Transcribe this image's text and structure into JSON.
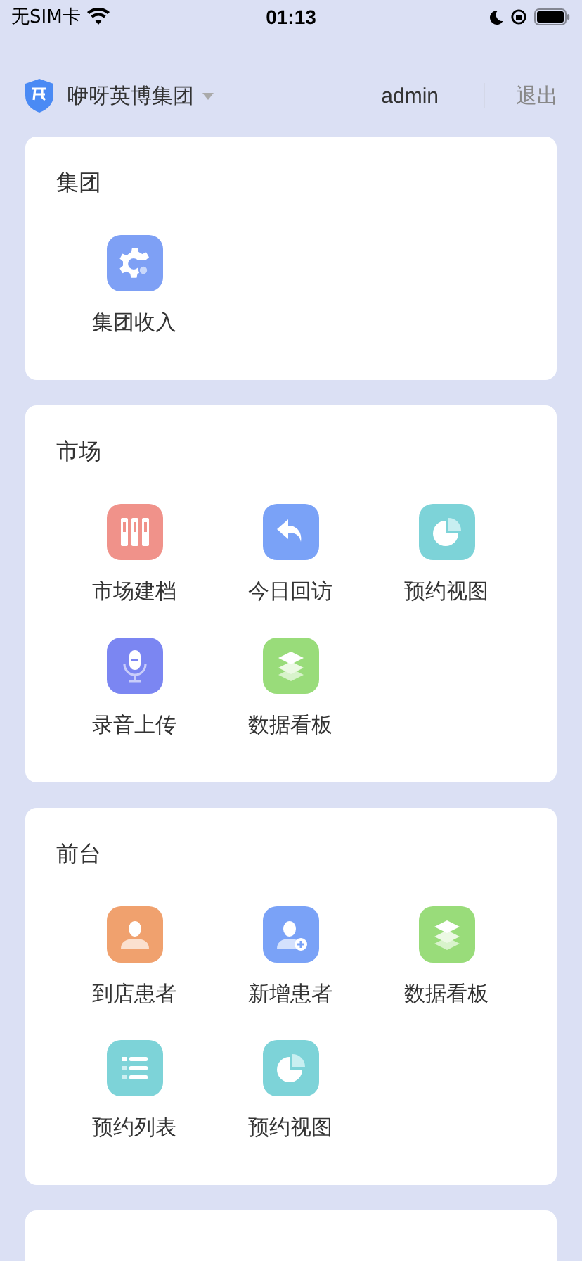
{
  "status_bar": {
    "carrier": "无SIM卡",
    "time": "01:13"
  },
  "header": {
    "org": "咿呀英博集团",
    "user": "admin",
    "logout": "退出"
  },
  "sections": [
    {
      "title": "集团",
      "items": [
        {
          "label": "集团收入",
          "kind": "gear",
          "color": "#7ea0f5"
        }
      ]
    },
    {
      "title": "市场",
      "items": [
        {
          "label": "市场建档",
          "kind": "binders",
          "color": "#f0928a"
        },
        {
          "label": "今日回访",
          "kind": "reply",
          "color": "#7aa2f7"
        },
        {
          "label": "预约视图",
          "kind": "pie",
          "color": "#7dd3d8"
        },
        {
          "label": "录音上传",
          "kind": "mic",
          "color": "#7b86f2"
        },
        {
          "label": "数据看板",
          "kind": "layers",
          "color": "#99dc7a"
        }
      ]
    },
    {
      "title": "前台",
      "items": [
        {
          "label": "到店患者",
          "kind": "person",
          "color": "#f0a16e"
        },
        {
          "label": "新增患者",
          "kind": "person-add",
          "color": "#7aa2f7"
        },
        {
          "label": "数据看板",
          "kind": "layers",
          "color": "#99dc7a"
        },
        {
          "label": "预约列表",
          "kind": "list",
          "color": "#7dd3d8"
        },
        {
          "label": "预约视图",
          "kind": "pie",
          "color": "#7dd3d8"
        }
      ]
    },
    {
      "kind": "partial"
    }
  ]
}
